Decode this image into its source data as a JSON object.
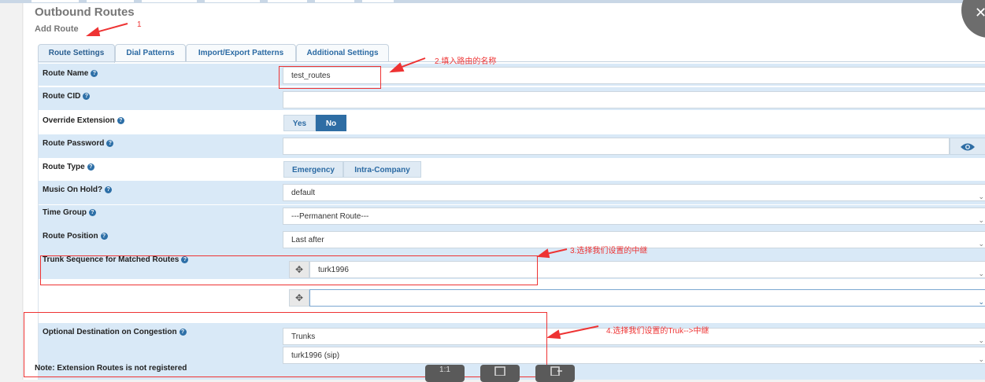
{
  "header": {
    "title": "Outbound Routes",
    "subtitle": "Add Route"
  },
  "tabs": [
    {
      "label": "Route Settings",
      "active": true
    },
    {
      "label": "Dial Patterns"
    },
    {
      "label": "Import/Export Patterns"
    },
    {
      "label": "Additional Settings"
    }
  ],
  "fields": {
    "route_name": {
      "label": "Route Name",
      "value": "test_routes"
    },
    "route_cid": {
      "label": "Route CID",
      "value": ""
    },
    "override_extension": {
      "label": "Override Extension",
      "options": [
        "Yes",
        "No"
      ],
      "selected": "No"
    },
    "route_password": {
      "label": "Route Password",
      "value": ""
    },
    "route_type": {
      "label": "Route Type",
      "options": [
        "Emergency",
        "Intra-Company"
      ]
    },
    "music_on_hold": {
      "label": "Music On Hold?",
      "value": "default"
    },
    "time_group": {
      "label": "Time Group",
      "value": "---Permanent Route---"
    },
    "route_position": {
      "label": "Route Position",
      "value": "Last after"
    },
    "trunk_sequence": {
      "label": "Trunk Sequence for Matched Routes",
      "values": [
        "turk1996",
        ""
      ]
    },
    "optional_destination": {
      "label": "Optional Destination on Congestion",
      "type_value": "Trunks",
      "target_value": "turk1996 (sip)"
    }
  },
  "note": "Note: Extension Routes is not registered",
  "annotations": {
    "a1": "1",
    "a2": "2.填入路由的名称",
    "a3": "3.选择我们设置的中继",
    "a4": "4.选择我们设置的Truk-->中继"
  },
  "dock": {
    "page": "1:1"
  },
  "icons": {
    "help": "question-circle-icon",
    "eye": "eye-icon",
    "drag": "move-arrows-icon",
    "caret": "chevron-down-icon",
    "close": "close-icon"
  },
  "colors": {
    "accent": "#2e6da4",
    "row_alt": "#d9e9f7",
    "annotation": "#ee3333"
  }
}
